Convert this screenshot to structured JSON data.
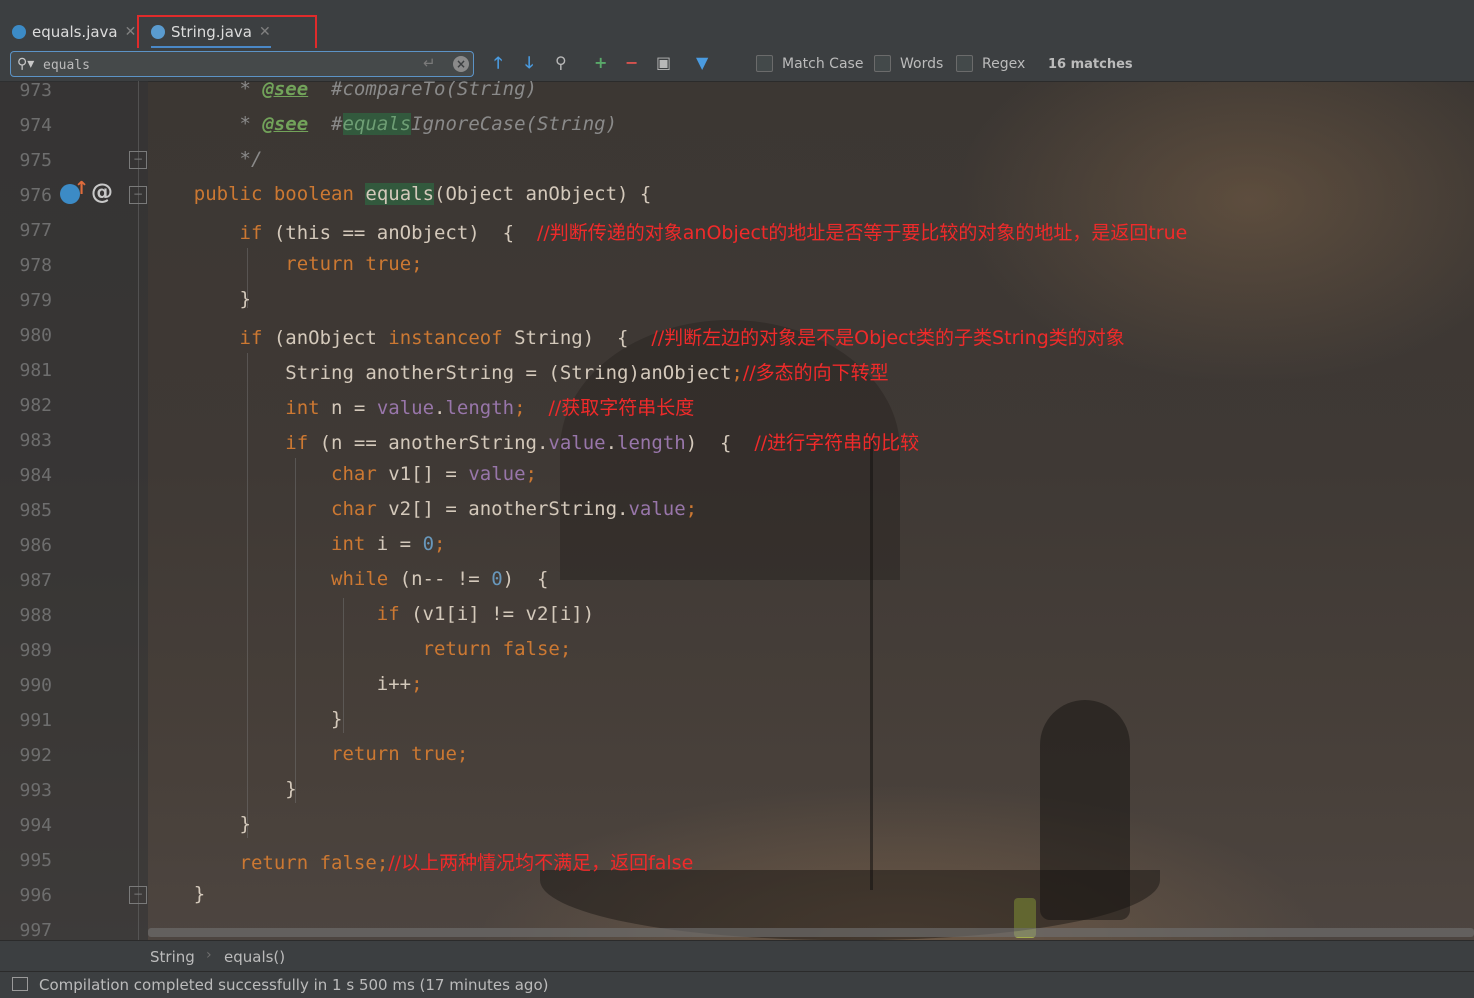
{
  "tabs": [
    {
      "label": "equals.java",
      "active": false,
      "icon": "java-class-icon"
    },
    {
      "label": "String.java",
      "active": true,
      "icon": "java-class-locked-icon"
    }
  ],
  "find": {
    "query": "equals",
    "options": [
      "Match Case",
      "Words",
      "Regex"
    ],
    "match_count": "16 matches"
  },
  "line_numbers": [
    "973",
    "974",
    "975",
    "976",
    "977",
    "978",
    "979",
    "980",
    "981",
    "982",
    "983",
    "984",
    "985",
    "986",
    "987",
    "988",
    "989",
    "990",
    "991",
    "992",
    "993",
    "994",
    "995",
    "996",
    "997"
  ],
  "code": {
    "l973": {
      "star": "* ",
      "tag": "@see",
      "text": "  #compareTo(String)"
    },
    "l974": {
      "star": "* ",
      "tag": "@see",
      "space": "  #",
      "match": "equals",
      "text": "IgnoreCase(String)"
    },
    "l975": {
      "text": "*/"
    },
    "l976": {
      "public": "public",
      "boolean": "boolean",
      "match": "equals",
      "text": "(Object anObject) {"
    },
    "l977": {
      "kw": "if",
      "text": " (this == anObject)  {",
      "ann": "//判断传递的对象anObject的地址是否等于要比较的对象的地址，是返回true"
    },
    "l978": {
      "kw": "return",
      "kw2": "true",
      "semi": ";"
    },
    "l979": {
      "text": "}"
    },
    "l980": {
      "kw": "if",
      "text1": " (anObject ",
      "kw2": "instanceof",
      "text2": " String)  {",
      "ann": "//判断左边的对象是不是Object类的子类String类的对象"
    },
    "l981": {
      "text": "String anotherString = (String)anObject",
      "semi": ";",
      "ann": "//多态的向下转型"
    },
    "l982": {
      "kw": "int",
      "text": " n = ",
      "fld": "value",
      "text2": ".",
      "fld2": "length",
      "semi": ";",
      "ann": "//获取字符串长度"
    },
    "l983": {
      "kw": "if",
      "text": " (n == anotherString.",
      "fld": "value",
      "text2": ".",
      "fld2": "length",
      "text3": ")  {",
      "ann": "//进行字符串的比较"
    },
    "l984": {
      "kw": "char",
      "text": " v1[] = ",
      "fld": "value",
      "semi": ";"
    },
    "l985": {
      "kw": "char",
      "text": " v2[] = anotherString.",
      "fld": "value",
      "semi": ";"
    },
    "l986": {
      "kw": "int",
      "text": " i = ",
      "num": "0",
      "semi": ";"
    },
    "l987": {
      "kw": "while",
      "text": " (n-- != ",
      "num": "0",
      "text2": ")  {"
    },
    "l988": {
      "kw": "if",
      "text": " (v1[i] != v2[i])"
    },
    "l989": {
      "kw": "return",
      "kw2": "false",
      "semi": ";"
    },
    "l990": {
      "text": "i++",
      "semi": ";"
    },
    "l991": {
      "text": "}"
    },
    "l992": {
      "kw": "return",
      "kw2": "true",
      "semi": ";"
    },
    "l993": {
      "text": "}"
    },
    "l994": {
      "text": "}"
    },
    "l995": {
      "kw": "return",
      "kw2": "false",
      "semi": ";",
      "ann": "//以上两种情况均不满足，返回false"
    },
    "l996": {
      "text": "}"
    },
    "l997": {
      "text": ""
    }
  },
  "gutter_icons": {
    "override": "override-up-icon",
    "at": "@"
  },
  "breadcrumb": [
    "String",
    "equals()"
  ],
  "status": "Compilation completed successfully in 1 s 500 ms (17 minutes ago)",
  "colors": {
    "annotation": "#f02a2a",
    "keyword": "#cc7832",
    "field": "#9876aa",
    "highlight_box": "#e02b2b"
  }
}
